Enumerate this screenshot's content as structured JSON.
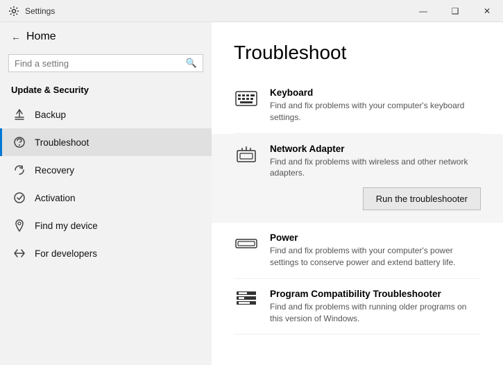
{
  "titlebar": {
    "title": "Settings",
    "back_label": "←",
    "minimize_label": "—",
    "maximize_label": "❑",
    "close_label": "✕"
  },
  "sidebar": {
    "back_label": "Home",
    "search_placeholder": "Find a setting",
    "section_title": "Update & Security",
    "items": [
      {
        "id": "backup",
        "label": "Backup",
        "icon": "backup"
      },
      {
        "id": "troubleshoot",
        "label": "Troubleshoot",
        "icon": "troubleshoot",
        "active": true
      },
      {
        "id": "recovery",
        "label": "Recovery",
        "icon": "recovery"
      },
      {
        "id": "activation",
        "label": "Activation",
        "icon": "activation"
      },
      {
        "id": "find-my-device",
        "label": "Find my device",
        "icon": "find-device"
      },
      {
        "id": "for-developers",
        "label": "For developers",
        "icon": "developers"
      }
    ]
  },
  "content": {
    "title": "Troubleshoot",
    "items": [
      {
        "id": "keyboard",
        "title": "Keyboard",
        "description": "Find and fix problems with your computer's keyboard settings.",
        "highlighted": false
      },
      {
        "id": "network-adapter",
        "title": "Network Adapter",
        "description": "Find and fix problems with wireless and other network adapters.",
        "highlighted": true,
        "button_label": "Run the troubleshooter"
      },
      {
        "id": "power",
        "title": "Power",
        "description": "Find and fix problems with your computer's power settings to conserve power and extend battery life.",
        "highlighted": false
      },
      {
        "id": "program-compatibility",
        "title": "Program Compatibility Troubleshooter",
        "description": "Find and fix problems with running older programs on this version of Windows.",
        "highlighted": false
      }
    ]
  }
}
